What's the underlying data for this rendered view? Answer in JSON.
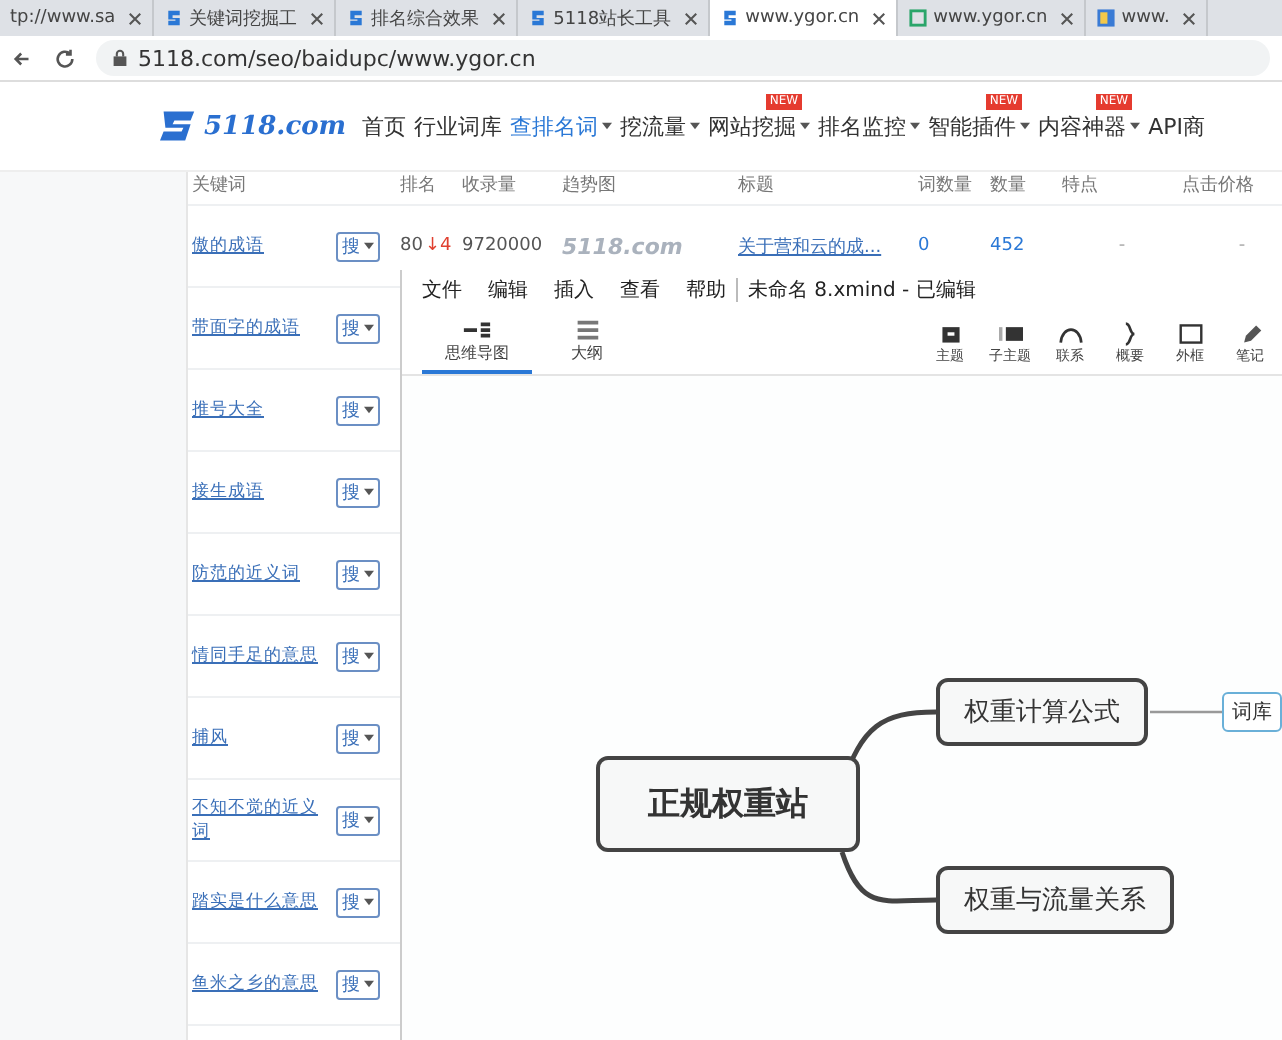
{
  "browser_tabs": [
    {
      "label": "tp://www.sa",
      "kind": "none",
      "selected": false
    },
    {
      "label": "关键词挖掘工",
      "kind": "logo",
      "selected": false
    },
    {
      "label": "排名综合效果",
      "kind": "logo",
      "selected": false
    },
    {
      "label": "5118站长工具",
      "kind": "logo",
      "selected": false
    },
    {
      "label": "www.ygor.cn",
      "kind": "logo",
      "selected": true
    },
    {
      "label": "www.ygor.cn",
      "kind": "square",
      "selected": false
    },
    {
      "label": "www.",
      "kind": "thumb",
      "selected": false
    }
  ],
  "address": "5118.com/seo/baidupc/www.ygor.cn",
  "site": {
    "logo": "5118.com",
    "nav": [
      {
        "label": "首页",
        "dropdown": false,
        "selected": false
      },
      {
        "label": "行业词库",
        "dropdown": false,
        "selected": false
      },
      {
        "label": "查排名词",
        "dropdown": true,
        "selected": true
      },
      {
        "label": "挖流量",
        "dropdown": true,
        "selected": false
      },
      {
        "label": "网站挖掘",
        "dropdown": true,
        "badge": "NEW",
        "selected": false
      },
      {
        "label": "排名监控",
        "dropdown": true,
        "selected": false
      },
      {
        "label": "智能插件",
        "dropdown": true,
        "badge": "NEW",
        "selected": false
      },
      {
        "label": "内容神器",
        "dropdown": true,
        "badge": "NEW",
        "selected": false
      },
      {
        "label": "API商",
        "dropdown": false,
        "selected": false
      }
    ]
  },
  "table": {
    "columns": [
      "关键词",
      "排名",
      "收录量",
      "趋势图",
      "标题",
      "词数量",
      "数量",
      "特点",
      "点击价格"
    ],
    "rows": [
      {
        "keyword": "傲的成语",
        "search": "搜",
        "rank": "80",
        "change": "↓4",
        "indexed": "9720000",
        "trend": "5118.com",
        "title": "关于营和云的成...",
        "count_1": "0",
        "count_2": "452",
        "feature": "-",
        "price": "-"
      },
      {
        "keyword": "带面字的成语",
        "search": "搜"
      },
      {
        "keyword": "推号大全",
        "search": "搜"
      },
      {
        "keyword": "接生成语",
        "search": "搜"
      },
      {
        "keyword": "防范的近义词",
        "search": "搜"
      },
      {
        "keyword": "情同手足的意思",
        "search": "搜"
      },
      {
        "keyword": "捕风",
        "search": "搜"
      },
      {
        "keyword": "不知不觉的近义词",
        "search": "搜"
      },
      {
        "keyword": "踏实是什么意思",
        "search": "搜"
      },
      {
        "keyword": "鱼米之乡的意思",
        "search": "搜"
      }
    ]
  },
  "xmind": {
    "menu": [
      "文件",
      "编辑",
      "插入",
      "查看",
      "帮助"
    ],
    "title": "未命名 8.xmind - 已编辑",
    "views": [
      {
        "label": "思维导图",
        "kind": "mindmap",
        "selected": true
      },
      {
        "label": "大纲",
        "kind": "outline",
        "selected": false
      }
    ],
    "tools": [
      {
        "label": "主题",
        "kind": "topic"
      },
      {
        "label": "子主题",
        "kind": "subtopic"
      },
      {
        "label": "联系",
        "kind": "relation"
      },
      {
        "label": "概要",
        "kind": "summary"
      },
      {
        "label": "外框",
        "kind": "boundary"
      },
      {
        "label": "笔记",
        "kind": "note"
      }
    ],
    "map": {
      "central": "正规权重站",
      "branches": [
        {
          "label": "权重计算公式",
          "children": [
            {
              "label": "词库"
            }
          ]
        },
        {
          "label": "权重与流量关系"
        }
      ]
    }
  }
}
